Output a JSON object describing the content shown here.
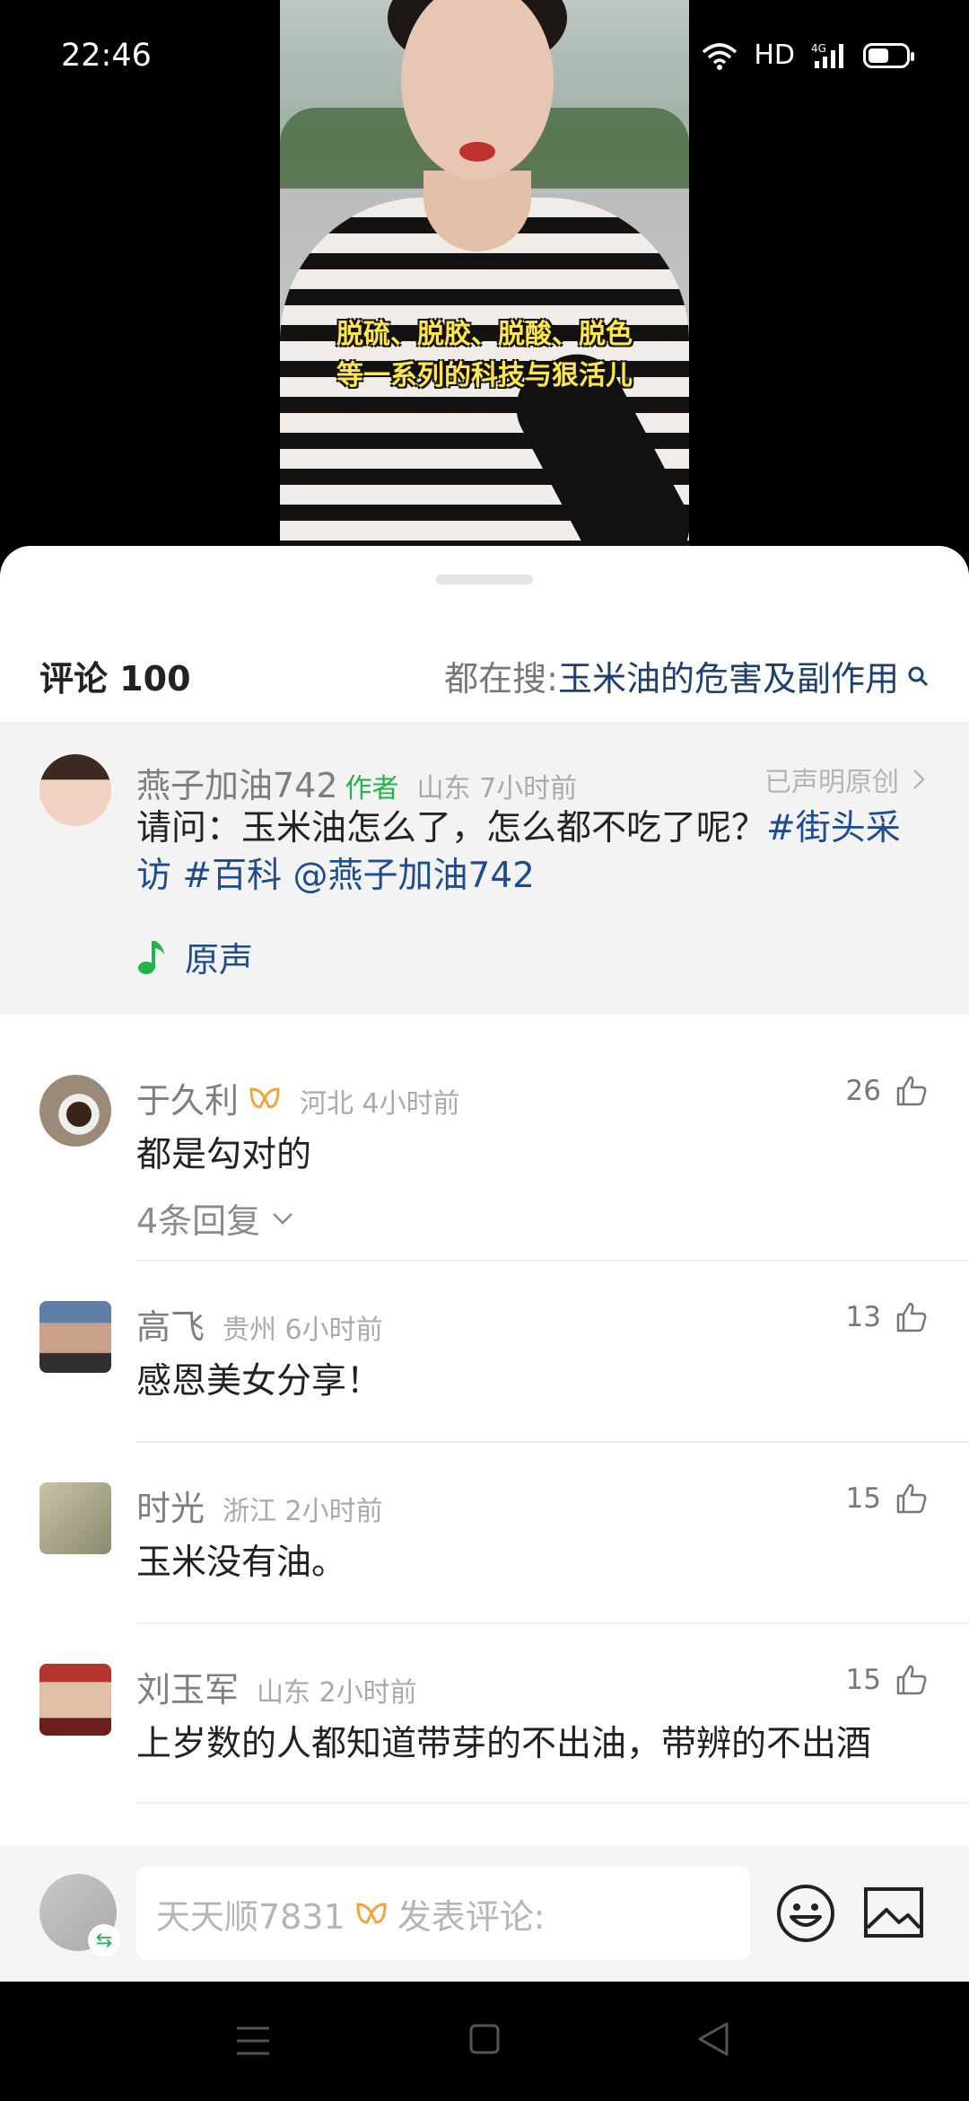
{
  "status_bar": {
    "time": "22:46",
    "hd": "HD",
    "network": "4G"
  },
  "video": {
    "caption_line1": "脱硫、脱胶、脱酸、脱色",
    "caption_line2": "等一系列的科技与狠活儿"
  },
  "header": {
    "comment_count": "评论 100",
    "search_prefix": "都在搜: ",
    "search_term": "玉米油的危害及副作用"
  },
  "author_post": {
    "name": "燕子加油742",
    "tag": "作者",
    "meta": "山东 7小时前",
    "original": "已声明原创",
    "text_main": "请问：玉米油怎么了，怎么都不吃了呢？",
    "hashtag1": "#街头采访",
    "hashtag2": "#百科",
    "mention": "@燕子加油742",
    "sound": "原声"
  },
  "comments": [
    {
      "name": "于久利",
      "meta": "河北 4小时前",
      "text": "都是勾对的",
      "likes": "26",
      "replies": "4条回复"
    },
    {
      "name": "高飞",
      "meta": "贵州 6小时前",
      "text": "感恩美女分享！",
      "likes": "13"
    },
    {
      "name": "时光",
      "meta": "浙江 2小时前",
      "text": "玉米没有油。",
      "likes": "15"
    },
    {
      "name": "刘玉军",
      "meta": "山东 2小时前",
      "text": "上岁数的人都知道带芽的不出油，带辨的不出酒",
      "likes": "15"
    }
  ],
  "input_bar": {
    "user": "天天顺7831",
    "placeholder": "发表评论:"
  },
  "colors": {
    "accent_green": "#23b24b",
    "link_blue": "#1f4c8c",
    "vip_orange": "#f0a53a"
  }
}
